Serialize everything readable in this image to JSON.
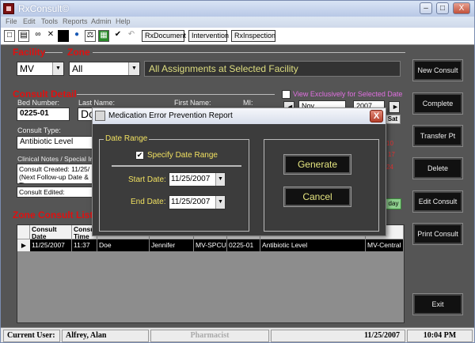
{
  "window": {
    "title": "RxConsult©",
    "min_glyph": "–",
    "max_glyph": "□",
    "close_glyph": "X"
  },
  "menu": [
    "File",
    "Edit",
    "Tools",
    "Reports",
    "Admin",
    "Help"
  ],
  "toolbar": {
    "icons": [
      "new-icon",
      "print-icon",
      "binoculars-icon",
      "delete-icon",
      "stop-icon",
      "globe-icon",
      "scales-icon",
      "calendar-icon",
      "check-icon",
      "undo-icon"
    ],
    "buttons": [
      "RxDocument",
      "Intervention",
      "RxInspection"
    ]
  },
  "facility": {
    "label": "Facility",
    "value": "MV"
  },
  "zone": {
    "label": "Zone",
    "value": "All"
  },
  "assignment_text": "All Assignments at Selected Facility",
  "consult_detail": {
    "label": "Consult Detail",
    "bed_label": "Bed Number:",
    "bed_value": "0225-01",
    "last_label": "Last Name:",
    "last_value": "Do",
    "first_label": "First Name:",
    "mi_label": "MI:",
    "type_label": "Consult Type:",
    "type_value": "Antibiotic Level",
    "notes_label": "Clinical Notes / Special Ins",
    "notes_lines": [
      "Consult Created:  11/25/",
      "(Next Follow-up Date & Tin"
    ],
    "edited_line": "Consult Edited:  11/25/20"
  },
  "view_exclusive": {
    "label": "View Exclusively for Selected Date"
  },
  "calendar": {
    "month": "Nov",
    "year": "2007",
    "nav_prev": "◄",
    "nav_next": "►",
    "sat_label": "Sat",
    "days": [
      "10",
      "17",
      "24"
    ],
    "today_label": "day"
  },
  "zone_list": {
    "label": "Zone Consult List -",
    "headers": [
      "Consult Date",
      "Consult Time",
      "",
      "",
      "",
      "",
      "",
      ""
    ],
    "row": [
      "11/25/2007",
      "11:37",
      "Doe",
      "Jennifer",
      "MV-SPCU",
      "0225-01",
      "Antibiotic Level",
      "MV-Central"
    ]
  },
  "side_buttons": [
    "New Consult",
    "Complete",
    "Transfer Pt",
    "Delete",
    "Edit Consult",
    "Print Consult",
    "Exit"
  ],
  "status": {
    "user_label": "Current User:",
    "user_value": "Alfrey, Alan",
    "role": "Pharmacist",
    "date": "11/25/2007",
    "time": "10:04 PM"
  },
  "dialog": {
    "title": "Medication Error Prevention Report",
    "close_glyph": "X",
    "range_label": "Date Range",
    "specify_label": "Specify Date Range",
    "specify_checked": true,
    "start_label": "Start Date:",
    "start_value": "11/25/2007",
    "end_label": "End Date:",
    "end_value": "11/25/2007",
    "generate_label": "Generate",
    "cancel_label": "Cancel"
  },
  "colors": {
    "accent_red": "#e01010",
    "dialog_text": "#f0e060",
    "panel": "#555555"
  }
}
